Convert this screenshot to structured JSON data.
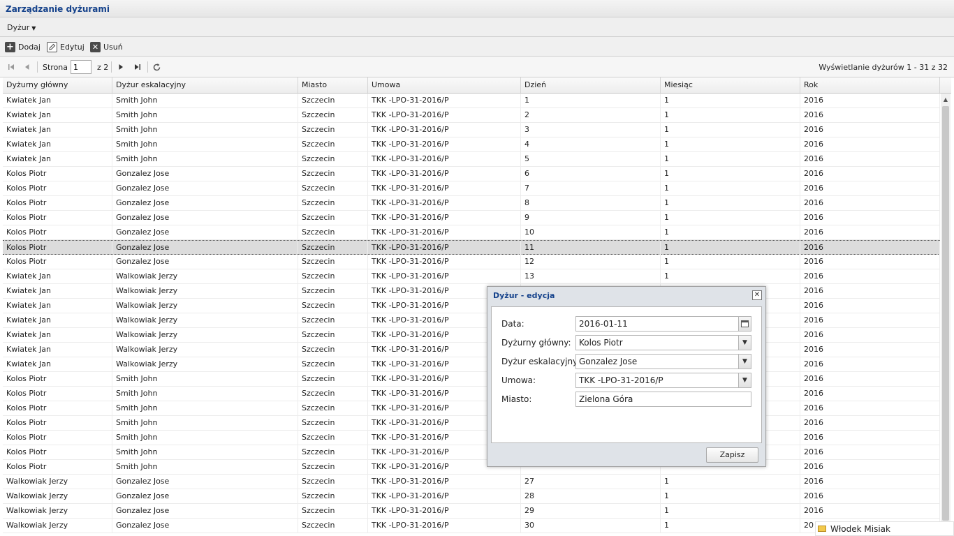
{
  "app": {
    "title": "Zarządzanie dyżurami"
  },
  "menu": {
    "duty_label": "Dyżur"
  },
  "toolbar": {
    "add_label": "Dodaj",
    "edit_label": "Edytuj",
    "delete_label": "Usuń"
  },
  "pager": {
    "page_label": "Strona",
    "page_value": "1",
    "of_label": "z 2",
    "display_info": "Wyświetlanie dyżurów 1 - 31 z 32"
  },
  "grid": {
    "columns": [
      "Dyżurny główny",
      "Dyżur eskalacyjny",
      "Miasto",
      "Umowa",
      "Dzień",
      "Miesiąc",
      "Rok"
    ],
    "selected_row": 10,
    "rows": [
      [
        "Kwiatek Jan",
        "Smith John",
        "Szczecin",
        "TKK -LPO-31-2016/P",
        "1",
        "1",
        "2016"
      ],
      [
        "Kwiatek Jan",
        "Smith John",
        "Szczecin",
        "TKK -LPO-31-2016/P",
        "2",
        "1",
        "2016"
      ],
      [
        "Kwiatek Jan",
        "Smith John",
        "Szczecin",
        "TKK -LPO-31-2016/P",
        "3",
        "1",
        "2016"
      ],
      [
        "Kwiatek Jan",
        "Smith John",
        "Szczecin",
        "TKK -LPO-31-2016/P",
        "4",
        "1",
        "2016"
      ],
      [
        "Kwiatek Jan",
        "Smith John",
        "Szczecin",
        "TKK -LPO-31-2016/P",
        "5",
        "1",
        "2016"
      ],
      [
        "Kolos Piotr",
        "Gonzalez Jose",
        "Szczecin",
        "TKK -LPO-31-2016/P",
        "6",
        "1",
        "2016"
      ],
      [
        "Kolos Piotr",
        "Gonzalez Jose",
        "Szczecin",
        "TKK -LPO-31-2016/P",
        "7",
        "1",
        "2016"
      ],
      [
        "Kolos Piotr",
        "Gonzalez Jose",
        "Szczecin",
        "TKK -LPO-31-2016/P",
        "8",
        "1",
        "2016"
      ],
      [
        "Kolos Piotr",
        "Gonzalez Jose",
        "Szczecin",
        "TKK -LPO-31-2016/P",
        "9",
        "1",
        "2016"
      ],
      [
        "Kolos Piotr",
        "Gonzalez Jose",
        "Szczecin",
        "TKK -LPO-31-2016/P",
        "10",
        "1",
        "2016"
      ],
      [
        "Kolos Piotr",
        "Gonzalez Jose",
        "Szczecin",
        "TKK -LPO-31-2016/P",
        "11",
        "1",
        "2016"
      ],
      [
        "Kolos Piotr",
        "Gonzalez Jose",
        "Szczecin",
        "TKK -LPO-31-2016/P",
        "12",
        "1",
        "2016"
      ],
      [
        "Kwiatek Jan",
        "Walkowiak Jerzy",
        "Szczecin",
        "TKK -LPO-31-2016/P",
        "13",
        "1",
        "2016"
      ],
      [
        "Kwiatek Jan",
        "Walkowiak Jerzy",
        "Szczecin",
        "TKK -LPO-31-2016/P",
        "",
        "",
        "2016"
      ],
      [
        "Kwiatek Jan",
        "Walkowiak Jerzy",
        "Szczecin",
        "TKK -LPO-31-2016/P",
        "",
        "",
        "2016"
      ],
      [
        "Kwiatek Jan",
        "Walkowiak Jerzy",
        "Szczecin",
        "TKK -LPO-31-2016/P",
        "",
        "",
        "2016"
      ],
      [
        "Kwiatek Jan",
        "Walkowiak Jerzy",
        "Szczecin",
        "TKK -LPO-31-2016/P",
        "",
        "",
        "2016"
      ],
      [
        "Kwiatek Jan",
        "Walkowiak Jerzy",
        "Szczecin",
        "TKK -LPO-31-2016/P",
        "",
        "",
        "2016"
      ],
      [
        "Kwiatek Jan",
        "Walkowiak Jerzy",
        "Szczecin",
        "TKK -LPO-31-2016/P",
        "",
        "",
        "2016"
      ],
      [
        "Kolos Piotr",
        "Smith John",
        "Szczecin",
        "TKK -LPO-31-2016/P",
        "",
        "",
        "2016"
      ],
      [
        "Kolos Piotr",
        "Smith John",
        "Szczecin",
        "TKK -LPO-31-2016/P",
        "",
        "",
        "2016"
      ],
      [
        "Kolos Piotr",
        "Smith John",
        "Szczecin",
        "TKK -LPO-31-2016/P",
        "",
        "",
        "2016"
      ],
      [
        "Kolos Piotr",
        "Smith John",
        "Szczecin",
        "TKK -LPO-31-2016/P",
        "",
        "",
        "2016"
      ],
      [
        "Kolos Piotr",
        "Smith John",
        "Szczecin",
        "TKK -LPO-31-2016/P",
        "",
        "",
        "2016"
      ],
      [
        "Kolos Piotr",
        "Smith John",
        "Szczecin",
        "TKK -LPO-31-2016/P",
        "",
        "",
        "2016"
      ],
      [
        "Kolos Piotr",
        "Smith John",
        "Szczecin",
        "TKK -LPO-31-2016/P",
        "",
        "",
        "2016"
      ],
      [
        "Walkowiak Jerzy",
        "Gonzalez Jose",
        "Szczecin",
        "TKK -LPO-31-2016/P",
        "27",
        "1",
        "2016"
      ],
      [
        "Walkowiak Jerzy",
        "Gonzalez Jose",
        "Szczecin",
        "TKK -LPO-31-2016/P",
        "28",
        "1",
        "2016"
      ],
      [
        "Walkowiak Jerzy",
        "Gonzalez Jose",
        "Szczecin",
        "TKK -LPO-31-2016/P",
        "29",
        "1",
        "2016"
      ],
      [
        "Walkowiak Jerzy",
        "Gonzalez Jose",
        "Szczecin",
        "TKK -LPO-31-2016/P",
        "30",
        "1",
        "20"
      ]
    ]
  },
  "dialog": {
    "title": "Dyżur - edycja",
    "date_label": "Data:",
    "date_value": "2016-01-11",
    "main_label": "Dyżurny główny:",
    "main_value": "Kolos Piotr",
    "escalation_label": "Dyżur eskalacyjny:",
    "escalation_value": "Gonzalez Jose",
    "contract_label": "Umowa:",
    "contract_value": "TKK -LPO-31-2016/P",
    "city_label": "Miasto:",
    "city_value": "Zielona Góra",
    "save_label": "Zapisz"
  },
  "user": {
    "name": "Włodek Misiak"
  }
}
